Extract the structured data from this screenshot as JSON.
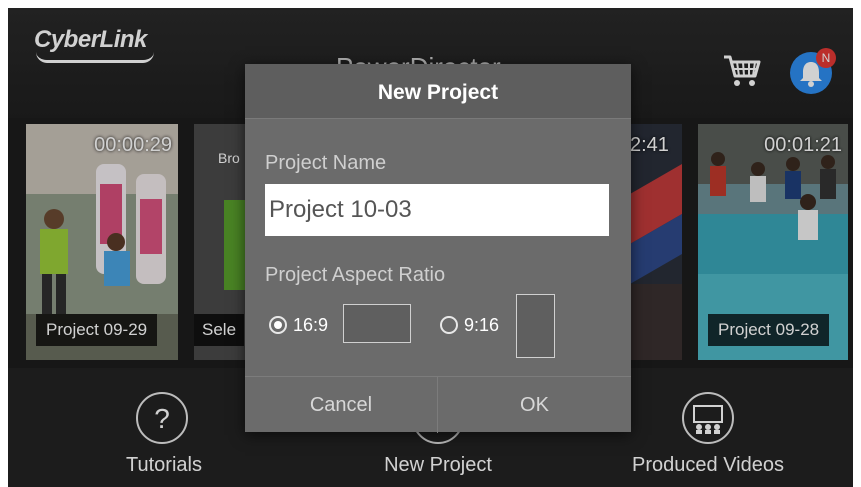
{
  "app": {
    "logo": "CyberLink",
    "title": "PowerDirector"
  },
  "header": {
    "cart_icon": "shopping-cart-icon",
    "bell_icon": "bell-icon",
    "notification_badge": "N"
  },
  "projects": [
    {
      "label": "Project 09-29",
      "duration": "00:00:29"
    },
    {
      "label": "Sele",
      "duration": "",
      "caption": "Bro"
    },
    {
      "label": "",
      "duration": "2:41"
    },
    {
      "label": "Project 09-28",
      "duration": "00:01:21"
    }
  ],
  "bottom": {
    "tutorials": "Tutorials",
    "tutorials_icon": "question-mark-icon",
    "new_project": "New Project",
    "produced_videos": "Produced Videos",
    "produced_icon": "cinema-audience-icon"
  },
  "dialog": {
    "title": "New Project",
    "name_label": "Project Name",
    "name_value": "Project 10-03",
    "aspect_label": "Project Aspect Ratio",
    "ratio_a": "16:9",
    "ratio_b": "9:16",
    "selected_ratio": "16:9",
    "cancel": "Cancel",
    "ok": "OK"
  },
  "colors": {
    "accent_blue": "#2e8df0",
    "badge_red": "#e53935",
    "dialog_bg": "#6b6b6b"
  }
}
